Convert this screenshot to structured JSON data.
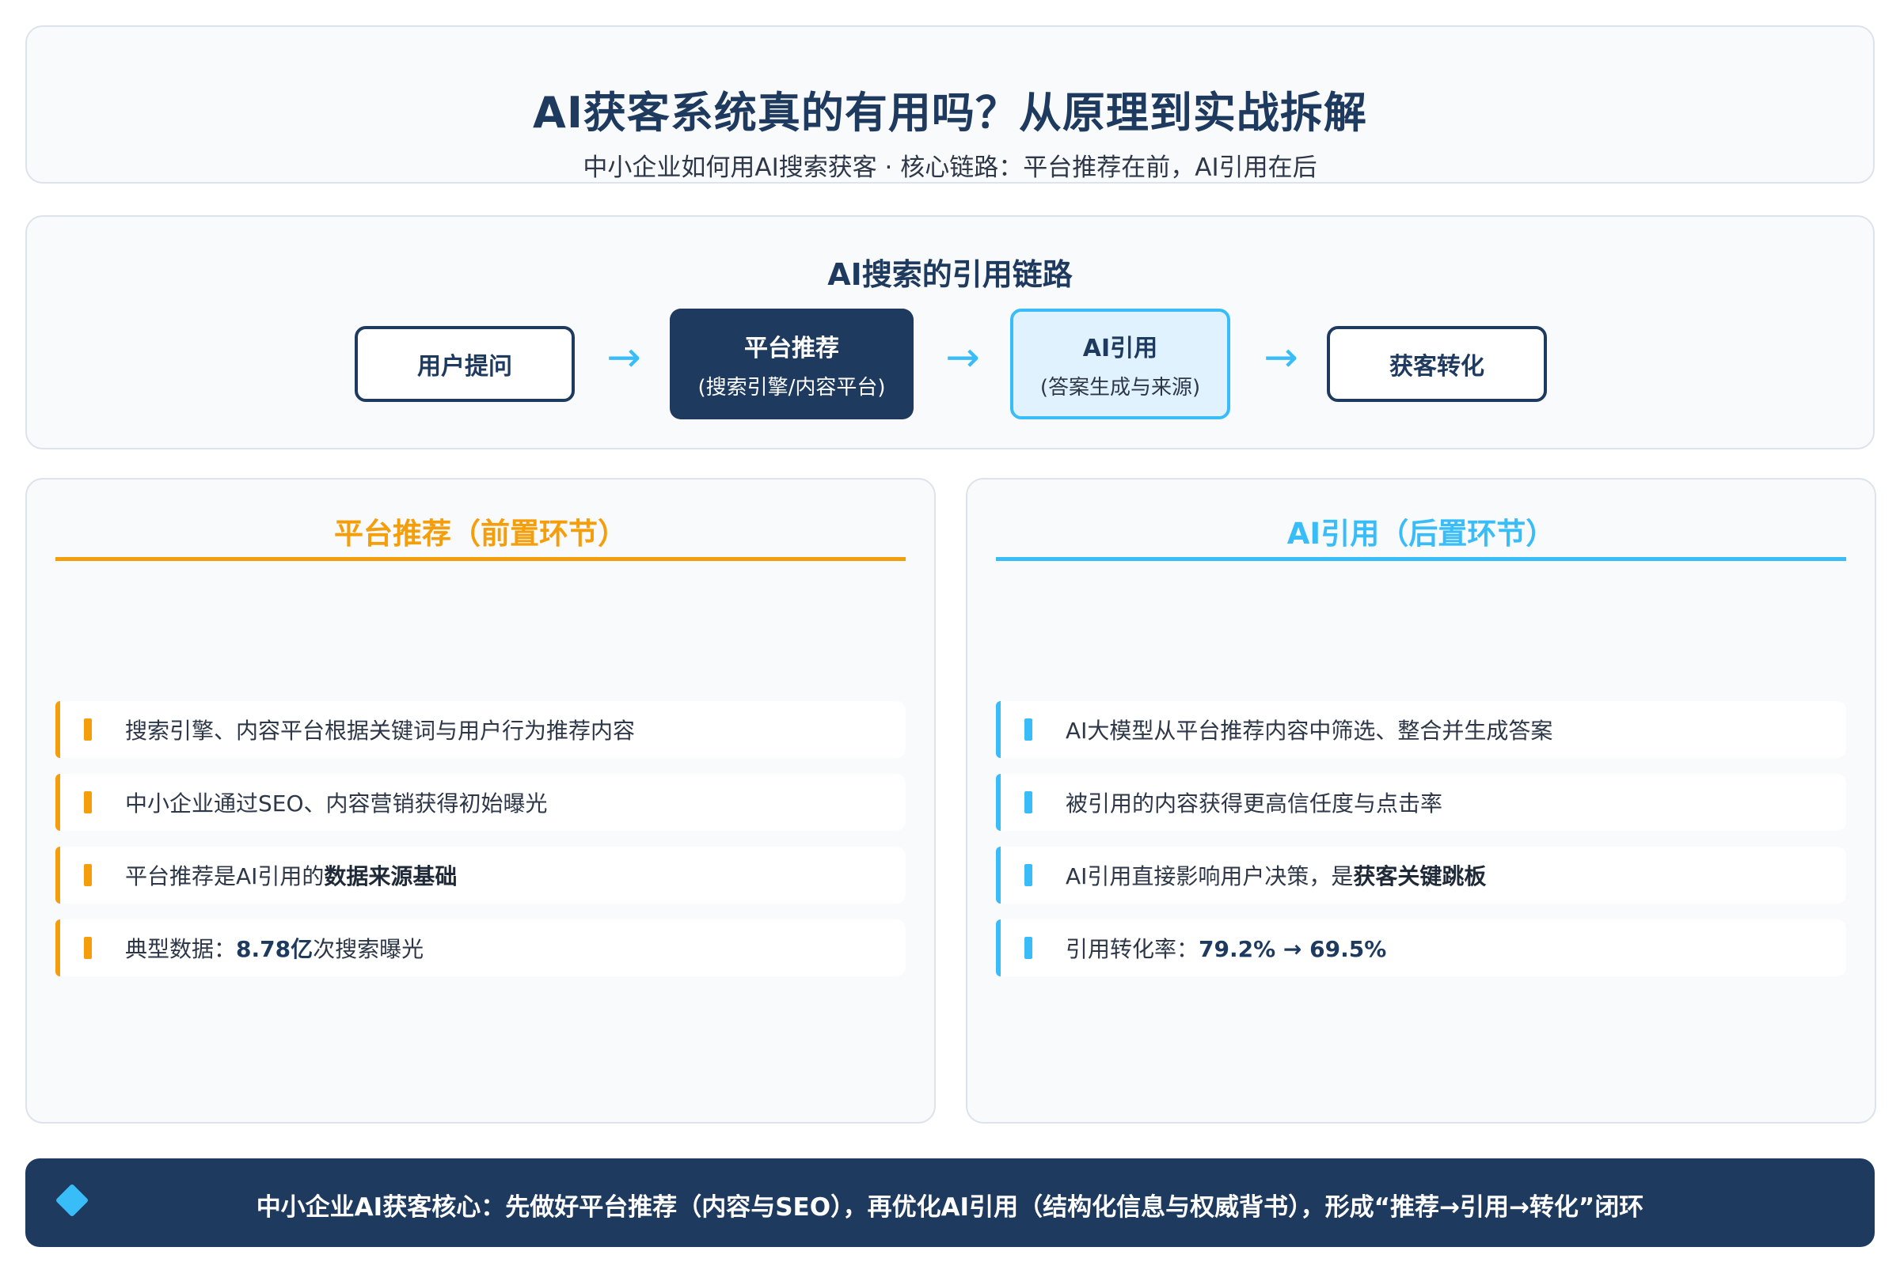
{
  "header": {
    "title": "AI获客系统真的有用吗？从原理到实战拆解",
    "subtitle": "中小企业如何用AI搜索获客 · 核心链路：平台推荐在前，AI引用在后"
  },
  "flow": {
    "title": "AI搜索的引用链路",
    "nodes": [
      {
        "label": "用户提问",
        "sub": ""
      },
      {
        "label": "平台推荐",
        "sub": "(搜索引擎/内容平台)"
      },
      {
        "label": "AI引用",
        "sub": "(答案生成与来源)"
      },
      {
        "label": "获客转化",
        "sub": ""
      }
    ],
    "arrow": "→"
  },
  "panel_left": {
    "title": "平台推荐（前置环节）",
    "items": [
      {
        "pre": "搜索引擎、内容平台根据关键词与用户行为推荐内容",
        "em": "",
        "post": ""
      },
      {
        "pre": "中小企业通过SEO、内容营销获得初始曝光",
        "em": "",
        "post": ""
      },
      {
        "pre": "平台推荐是AI引用的",
        "em": "数据来源基础",
        "post": ""
      },
      {
        "pre": "典型数据：",
        "em": "8.78亿",
        "post": "次搜索曝光"
      }
    ]
  },
  "panel_right": {
    "title": "AI引用（后置环节）",
    "items": [
      {
        "pre": "AI大模型从平台推荐内容中筛选、整合并生成答案",
        "em": "",
        "post": ""
      },
      {
        "pre": "被引用的内容获得更高信任度与点击率",
        "em": "",
        "post": ""
      },
      {
        "pre": "AI引用直接影响用户决策，是",
        "em": "获客关键跳板",
        "post": ""
      },
      {
        "pre": "引用转化率：",
        "em": "79.2% → 69.5%",
        "post": ""
      }
    ]
  },
  "footer": {
    "text": "中小企业AI获客核心：先做好平台推荐（内容与SEO），再优化AI引用（结构化信息与权威背书），形成“推荐→引用→转化”闭环"
  },
  "colors": {
    "navy": "#1e3a5f",
    "orange": "#f59e0b",
    "sky": "#38bdf8",
    "light_sky": "#e0f2fe"
  }
}
